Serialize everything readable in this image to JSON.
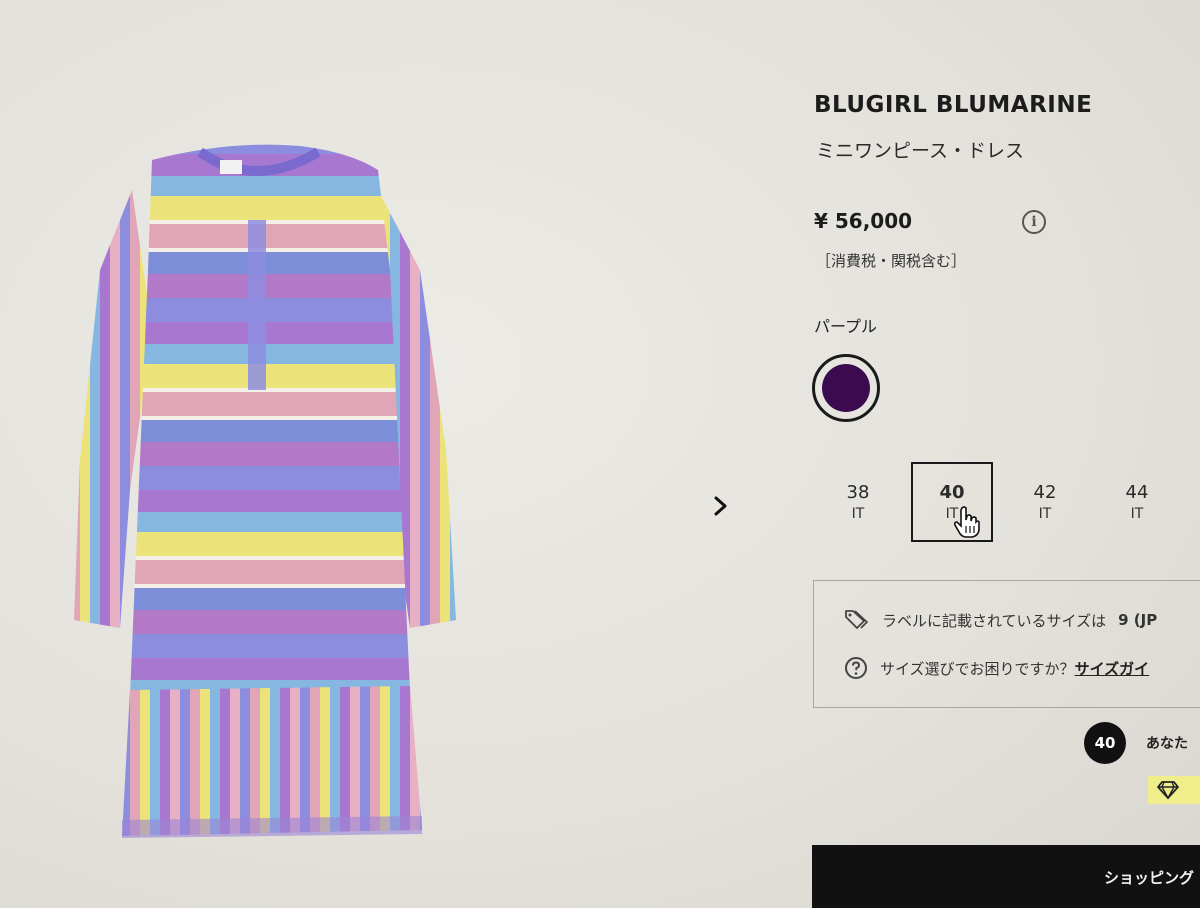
{
  "product": {
    "brand": "BLUGIRL BLUMARINE",
    "name": "ミニワンピース・ドレス",
    "price": "¥ 56,000",
    "tax_note": "［消費税・関税含む］",
    "info_icon": "i"
  },
  "color": {
    "label": "パープル",
    "swatch_hex": "#3b0a4f"
  },
  "sizes": [
    {
      "num": "38",
      "unit": "IT",
      "selected": false
    },
    {
      "num": "40",
      "unit": "IT",
      "selected": true
    },
    {
      "num": "42",
      "unit": "IT",
      "selected": false
    },
    {
      "num": "44",
      "unit": "IT",
      "selected": false
    }
  ],
  "size_info": {
    "label_text": "ラベルに記載されているサイズは",
    "label_value": "9 (JP",
    "help_text": "サイズ選びでお困りですか？",
    "guide_link": "サイズガイ"
  },
  "badge": {
    "number": "40",
    "text": "あなた"
  },
  "cart_button": "ショッピング",
  "icons": {
    "next": "chevron-right-icon",
    "tag": "tag-icon",
    "help": "question-circle-icon",
    "gem": "diamond-icon",
    "cursor": "hand-pointer-icon"
  },
  "colors": {
    "background": "#e6e3dd",
    "text": "#1c1c1c",
    "button": "#111111",
    "gem_tag": "#f0ee8a"
  }
}
